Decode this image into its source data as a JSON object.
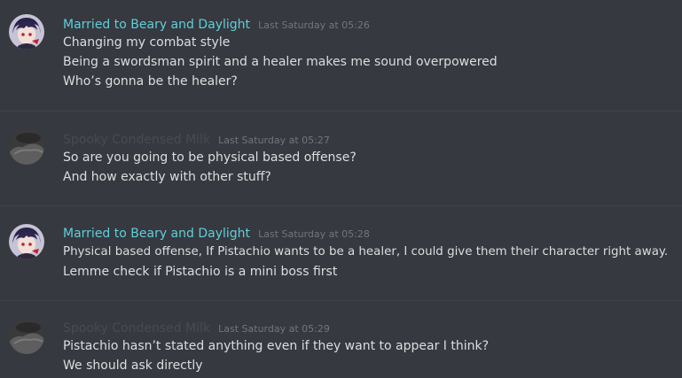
{
  "colors": {
    "background": "#36393f",
    "username_teal": "#5fcfdb",
    "username_dim": "#484b52",
    "timestamp": "#72767d",
    "text": "#dcddde"
  },
  "messages": [
    {
      "author": "Married to Beary and Daylight",
      "author_color": "#5fcfdb",
      "timestamp": "Last Saturday at 05:26",
      "avatar_icon": "anime-character-avatar",
      "lines": [
        "Changing my combat style",
        "Being a swordsman spirit and a healer makes me sound overpowered",
        "Who’s gonna be the healer?"
      ]
    },
    {
      "author": "Spooky Condensed Milk",
      "author_color": "#484b52",
      "timestamp": "Last Saturday at 05:27",
      "avatar_icon": "gray-blob-avatar",
      "lines": [
        "So are you going to be physical based offense?",
        "And how exactly with other stuff?"
      ]
    },
    {
      "author": "Married to Beary and Daylight",
      "author_color": "#5fcfdb",
      "timestamp": "Last Saturday at 05:28",
      "avatar_icon": "anime-character-avatar",
      "lines": [
        "Physical based offense, If Pistachio wants to be a healer, I could give them their character right away.",
        "Lemme check if Pistachio is a mini boss first"
      ]
    },
    {
      "author": "Spooky Condensed Milk",
      "author_color": "#484b52",
      "timestamp": "Last Saturday at 05:29",
      "avatar_icon": "gray-blob-avatar",
      "lines": [
        "Pistachio hasn’t stated anything even if they want to appear I think?",
        "We should ask directly"
      ]
    }
  ]
}
